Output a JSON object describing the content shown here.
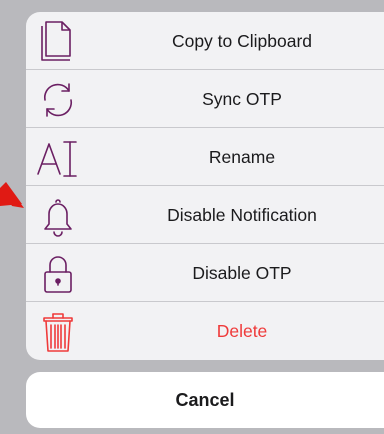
{
  "colors": {
    "icon": "#6b1f63",
    "destructive": "#ef3a3a",
    "pointer_arrow": "#e01a14"
  },
  "action_sheet": {
    "items": [
      {
        "icon": "copy-icon",
        "label": "Copy to Clipboard"
      },
      {
        "icon": "sync-icon",
        "label": "Sync OTP"
      },
      {
        "icon": "rename-icon",
        "label": "Rename"
      },
      {
        "icon": "bell-icon",
        "label": "Disable Notification"
      },
      {
        "icon": "lock-icon",
        "label": "Disable OTP"
      },
      {
        "icon": "trash-icon",
        "label": "Delete"
      }
    ],
    "cancel_label": "Cancel"
  }
}
